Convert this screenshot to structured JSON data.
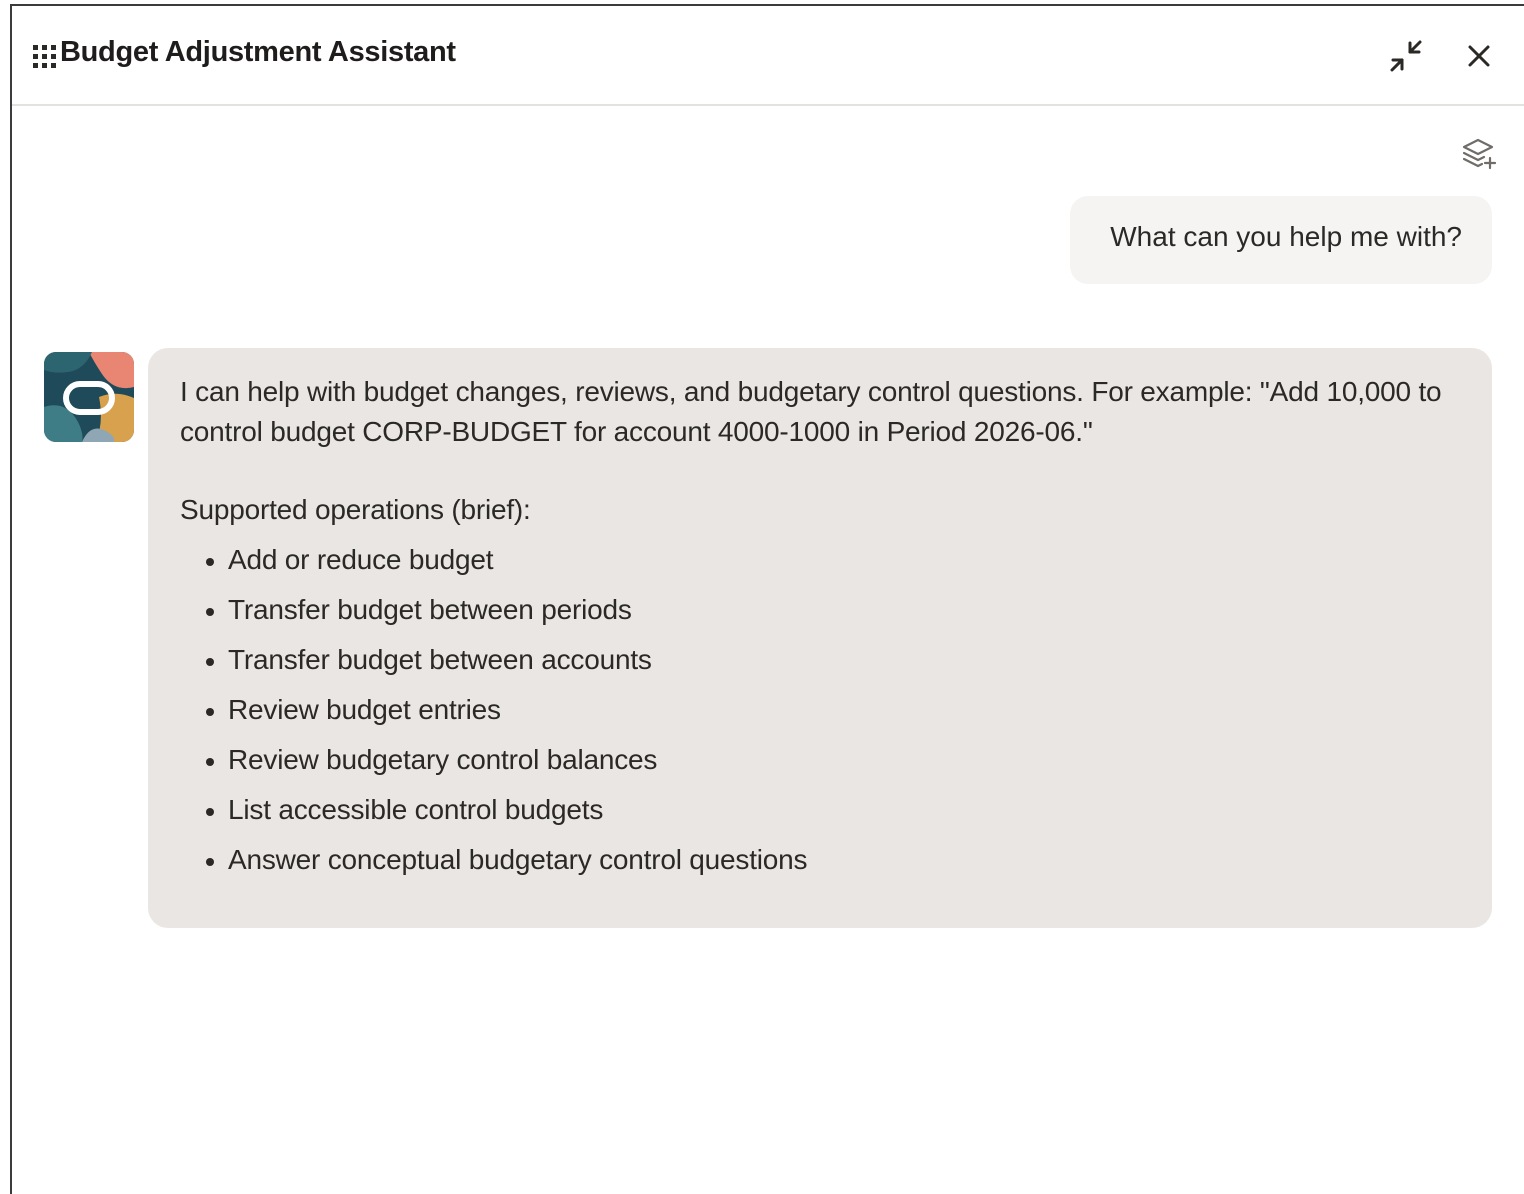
{
  "header": {
    "title": "Budget Adjustment Assistant",
    "drag_icon": "grip-dots-icon",
    "minimize_icon": "minimize-arrows-icon",
    "close_icon": "close-icon"
  },
  "toolbar": {
    "new_conversation_icon": "layers-plus-icon"
  },
  "conversation": {
    "user_message": "What can you help me with?",
    "assistant": {
      "avatar_icon": "oracle-assistant-avatar",
      "intro": "I can help with budget changes, reviews, and budgetary control questions. For example: \"Add 10,000 to control budget CORP-BUDGET for account 4000-1000 in Period 2026-06.\"",
      "operations_heading": "Supported operations (brief):",
      "operations": [
        "Add or reduce budget",
        "Transfer budget between periods",
        "Transfer budget between accounts",
        "Review budget entries",
        "Review budgetary control balances",
        "List accessible control budgets",
        "Answer conceptual budgetary control questions"
      ]
    }
  },
  "colors": {
    "user_bubble": "#f5f4f2",
    "assistant_bubble": "#e9e6e3",
    "text": "#2b2926",
    "divider": "#e4e2df"
  }
}
